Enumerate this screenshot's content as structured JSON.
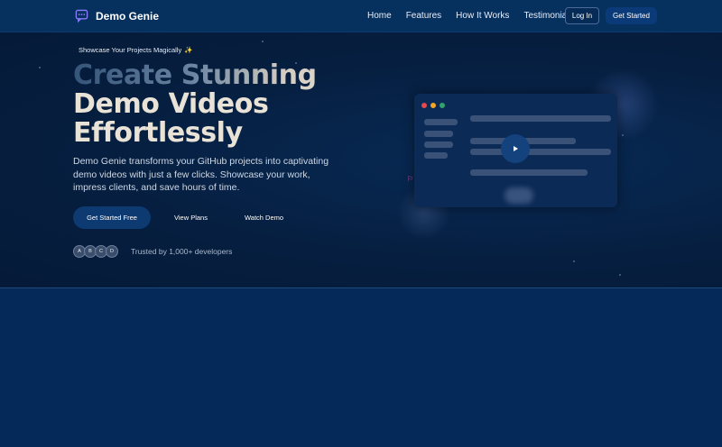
{
  "nav": {
    "brand": "Demo Genie",
    "links": [
      "Home",
      "Features",
      "How It Works",
      "Testimonials"
    ],
    "login": "Log In",
    "get_started": "Get Started"
  },
  "hero": {
    "tagline": "Showcase Your Projects Magically",
    "tagline_icon": "✨",
    "headline_line1": "Create Stunning",
    "headline_line2": "Demo Videos",
    "headline_line3": "Effortlessly",
    "description": "Demo Genie transforms your GitHub projects into captivating demo videos with just a few clicks. Showcase your work, impress clients, and save hours of time.",
    "cta_primary": "Get Started Free",
    "cta_plans": "View Plans",
    "cta_demo": "Watch Demo",
    "avatars": [
      "A",
      "B",
      "C",
      "D"
    ],
    "trusted": "Trusted by 1,000+ developers"
  },
  "mock": {
    "window_dots": [
      "#e5484d",
      "#f5a524",
      "#30a46c"
    ],
    "play_icon": "play-icon"
  },
  "colors": {
    "accent": "#0a3a78",
    "background": "#052a5a",
    "hero": "#061e3f"
  }
}
